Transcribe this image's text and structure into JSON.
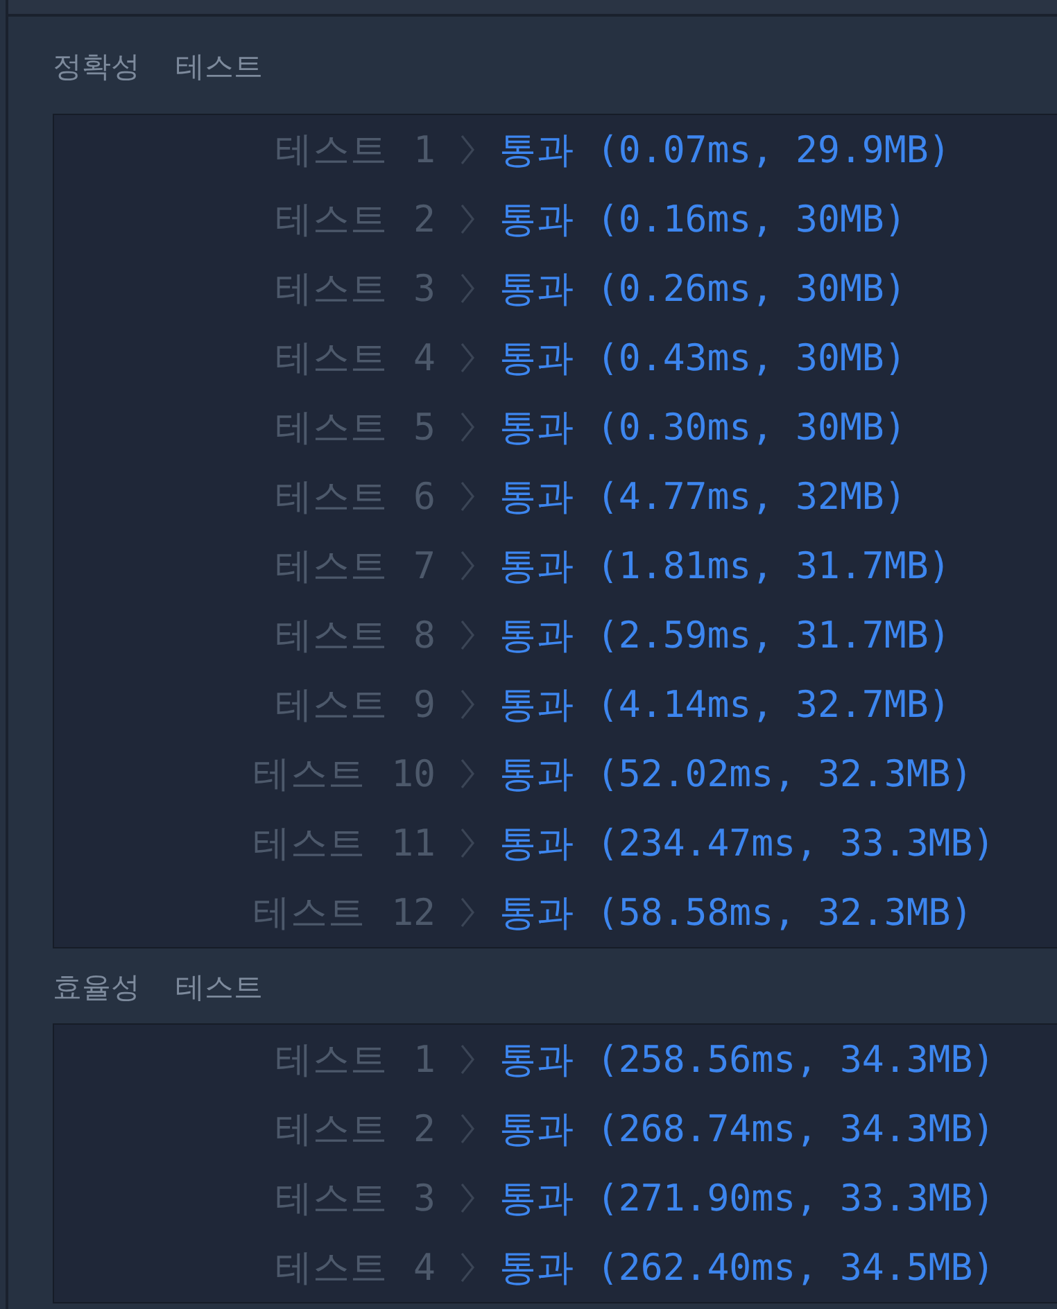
{
  "sections": [
    {
      "title": "정확성 테스트",
      "results": [
        {
          "label": "테스트 1",
          "status": "통과",
          "detail": "(0.07ms, 29.9MB)"
        },
        {
          "label": "테스트 2",
          "status": "통과",
          "detail": "(0.16ms, 30MB)"
        },
        {
          "label": "테스트 3",
          "status": "통과",
          "detail": "(0.26ms, 30MB)"
        },
        {
          "label": "테스트 4",
          "status": "통과",
          "detail": "(0.43ms, 30MB)"
        },
        {
          "label": "테스트 5",
          "status": "통과",
          "detail": "(0.30ms, 30MB)"
        },
        {
          "label": "테스트 6",
          "status": "통과",
          "detail": "(4.77ms, 32MB)"
        },
        {
          "label": "테스트 7",
          "status": "통과",
          "detail": "(1.81ms, 31.7MB)"
        },
        {
          "label": "테스트 8",
          "status": "통과",
          "detail": "(2.59ms, 31.7MB)"
        },
        {
          "label": "테스트 9",
          "status": "통과",
          "detail": "(4.14ms, 32.7MB)"
        },
        {
          "label": "테스트 10",
          "status": "통과",
          "detail": "(52.02ms, 32.3MB)"
        },
        {
          "label": "테스트 11",
          "status": "통과",
          "detail": "(234.47ms, 33.3MB)"
        },
        {
          "label": "테스트 12",
          "status": "통과",
          "detail": "(58.58ms, 32.3MB)"
        }
      ]
    },
    {
      "title": "효율성 테스트",
      "results": [
        {
          "label": "테스트 1",
          "status": "통과",
          "detail": "(258.56ms, 34.3MB)"
        },
        {
          "label": "테스트 2",
          "status": "통과",
          "detail": "(268.74ms, 34.3MB)"
        },
        {
          "label": "테스트 3",
          "status": "통과",
          "detail": "(271.90ms, 33.3MB)"
        },
        {
          "label": "테스트 4",
          "status": "통과",
          "detail": "(262.40ms, 34.5MB)"
        }
      ]
    }
  ]
}
